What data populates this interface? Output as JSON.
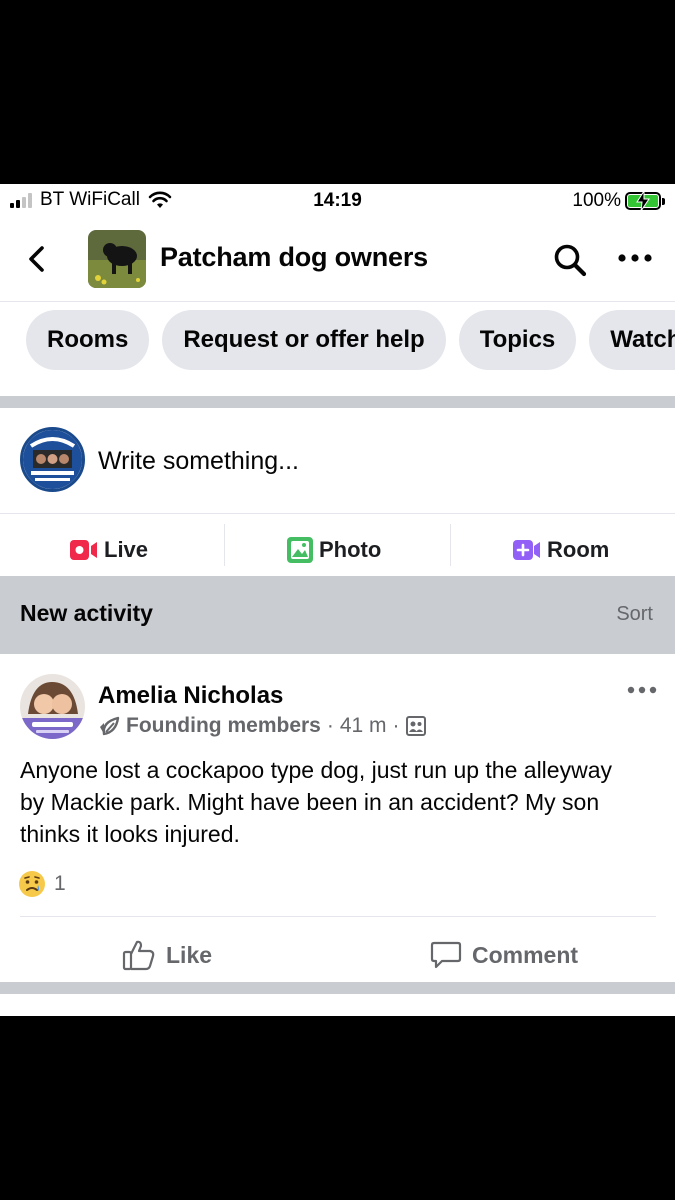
{
  "status_bar": {
    "carrier": "BT WiFiCall",
    "time": "14:19",
    "battery": "100%"
  },
  "header": {
    "group_name": "Patcham dog owners"
  },
  "chips": [
    {
      "label": "Rooms"
    },
    {
      "label": "Request or offer help"
    },
    {
      "label": "Topics"
    },
    {
      "label": "Watch"
    }
  ],
  "composer": {
    "prompt": "Write something..."
  },
  "actions": {
    "live": "Live",
    "photo": "Photo",
    "room": "Room"
  },
  "activity": {
    "title": "New activity",
    "sort": "Sort"
  },
  "post": {
    "author": "Amelia Nicholas",
    "badge": "Founding members",
    "time": "41 m",
    "body": "Anyone lost a cockapoo type dog, just run up the alleyway by Mackie park. Might have been in an accident? My son thinks it looks injured.",
    "reaction_count": "1",
    "like": "Like",
    "comment": "Comment"
  },
  "colors": {
    "live_red": "#f02849",
    "photo_green": "#45bd62",
    "room_purple": "#9360f7",
    "chip_bg": "#e4e6eb",
    "section_bg": "#c9ccd1"
  }
}
